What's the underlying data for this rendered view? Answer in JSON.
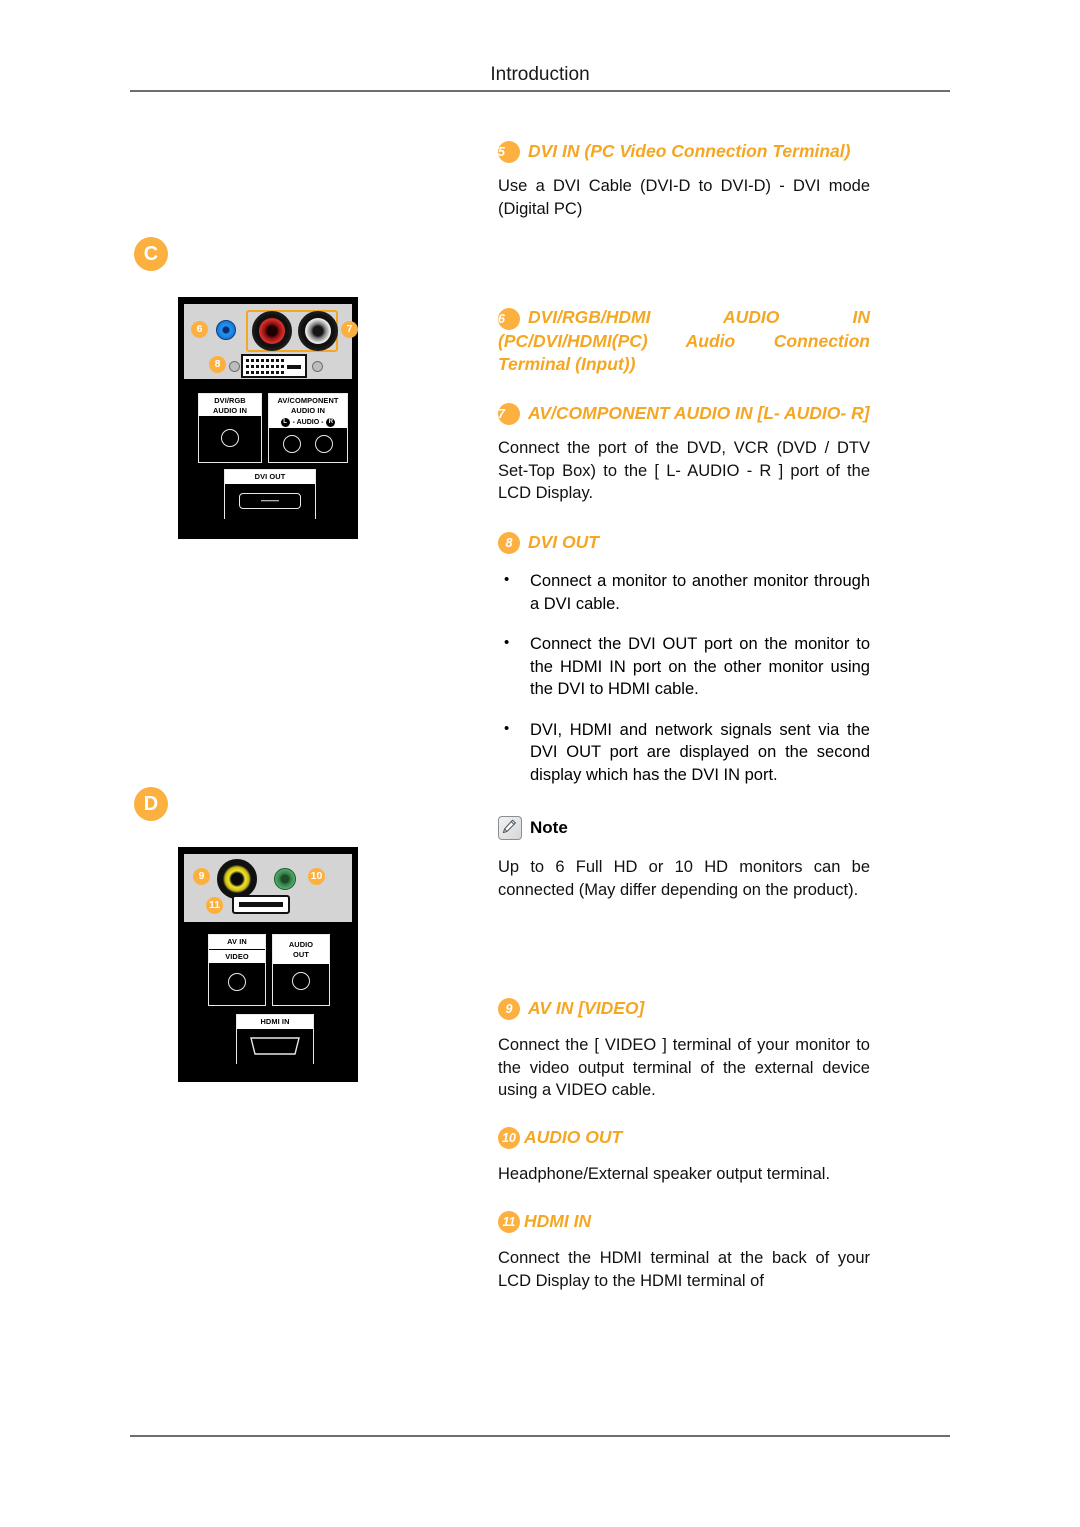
{
  "header": {
    "title": "Introduction"
  },
  "sections": {
    "item5": {
      "number": "5",
      "heading": "DVI IN (PC Video Connection Terminal)",
      "body": "Use a DVI Cable (DVI-D to DVI-D) - DVI mode (Digital PC)"
    },
    "item6": {
      "number": "6",
      "heading": "DVI/RGB/HDMI AUDIO IN (PC/DVI/HDMI(PC) Audio Connection Terminal (Input))"
    },
    "item7": {
      "number": "7",
      "heading": "AV/COMPONENT AUDIO IN [L- AUDIO- R]",
      "body": "Connect the port of the DVD, VCR (DVD / DTV Set-Top Box) to the [ L- AUDIO - R ] port of the LCD Display."
    },
    "item8": {
      "number": "8",
      "heading": "DVI OUT",
      "bullets": [
        "Connect a monitor to another monitor through a DVI cable.",
        "Connect the DVI OUT port on the monitor to the HDMI IN port on the other monitor using the DVI to HDMI cable.",
        "DVI, HDMI and network signals sent via the DVI OUT port are displayed on the second display which has the DVI IN port."
      ]
    },
    "note": {
      "label": "Note",
      "body": "Up to 6 Full HD or 10 HD monitors can be connected (May differ depending on the product)."
    },
    "item9": {
      "number": "9",
      "heading": "AV IN [VIDEO]",
      "body": "Connect the [ VIDEO ] terminal of your monitor to the video output terminal of the external device using a VIDEO cable."
    },
    "item10": {
      "number": "10",
      "heading": "AUDIO OUT",
      "body": "Headphone/External speaker output terminal."
    },
    "item11": {
      "number": "11",
      "heading": "HDMI IN",
      "body": "Connect the HDMI terminal at the back of your LCD Display to the HDMI terminal of"
    }
  },
  "figures": {
    "figureC": {
      "marker": "C",
      "callouts": {
        "six": "6",
        "seven": "7",
        "eight": "8"
      },
      "ports": {
        "dvi_rgb_audio_in": "DVI/RGB\nAUDIO IN",
        "dvi_rgb_audio_in_l1": "DVI/RGB",
        "dvi_rgb_audio_in_l2": "AUDIO IN",
        "av_component_l1": "AV/COMPONENT",
        "av_component_l2": "AUDIO IN",
        "lr_left": "L",
        "lr_mid": "- AUDIO -",
        "lr_right": "R",
        "dvi_out": "DVI OUT"
      }
    },
    "figureD": {
      "marker": "D",
      "callouts": {
        "nine": "9",
        "ten": "10",
        "eleven": "11"
      },
      "ports": {
        "av_in": "AV IN",
        "video": "VIDEO",
        "audio_out_l1": "AUDIO",
        "audio_out_l2": "OUT",
        "hdmi_in": "HDMI IN"
      }
    }
  },
  "colors": {
    "accent_orange": "#fbb040",
    "heading_orange": "#f5a623",
    "rule_gray": "#6b6e73"
  }
}
